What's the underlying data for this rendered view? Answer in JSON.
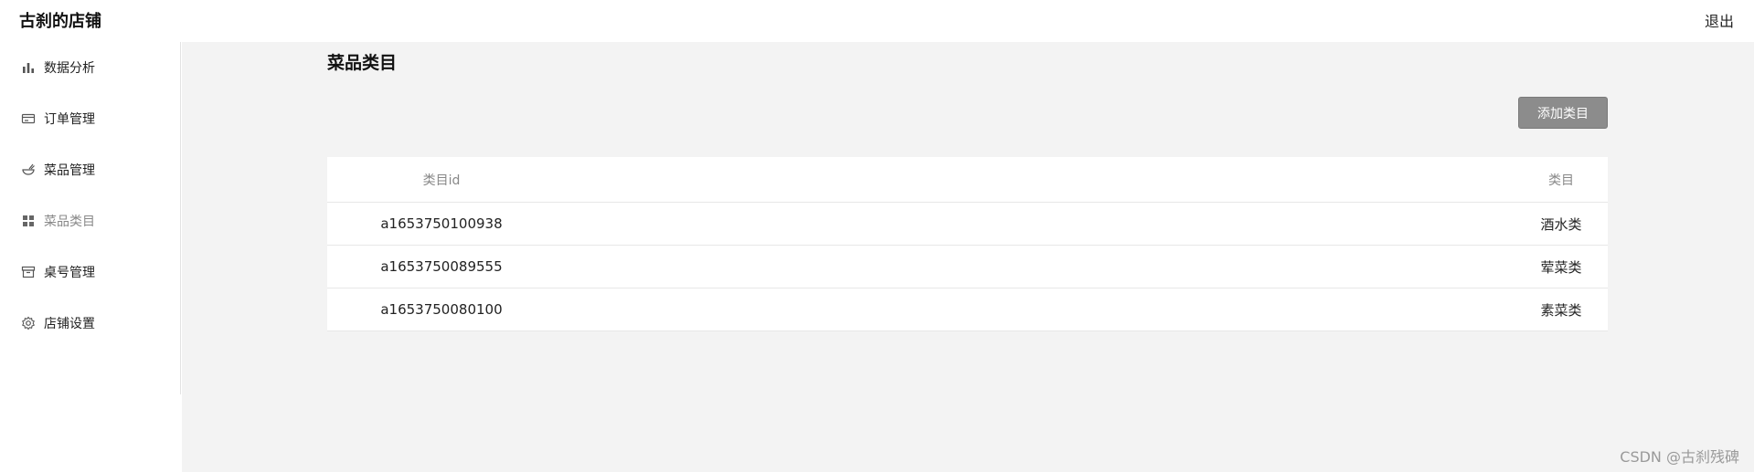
{
  "header": {
    "shop_title": "古刹的店铺",
    "logout_label": "退出"
  },
  "sidebar": {
    "items": [
      {
        "label": "数据分析",
        "icon": "bar-chart-icon"
      },
      {
        "label": "订单管理",
        "icon": "card-icon"
      },
      {
        "label": "菜品管理",
        "icon": "bowl-icon"
      },
      {
        "label": "菜品类目",
        "icon": "grid-icon",
        "active": true
      },
      {
        "label": "桌号管理",
        "icon": "box-icon"
      },
      {
        "label": "店铺设置",
        "icon": "gear-icon"
      }
    ]
  },
  "main": {
    "page_title": "菜品类目",
    "add_button_label": "添加类目",
    "table": {
      "columns": [
        "类目id",
        "类目"
      ],
      "rows": [
        [
          "a1653750100938",
          "酒水类"
        ],
        [
          "a1653750089555",
          "荤菜类"
        ],
        [
          "a1653750080100",
          "素菜类"
        ]
      ]
    }
  },
  "watermark": "CSDN @古刹残碑",
  "colors": {
    "content_bg": "#f3f3f3",
    "button_bg": "#8c8c8c",
    "active_text": "#888888"
  }
}
